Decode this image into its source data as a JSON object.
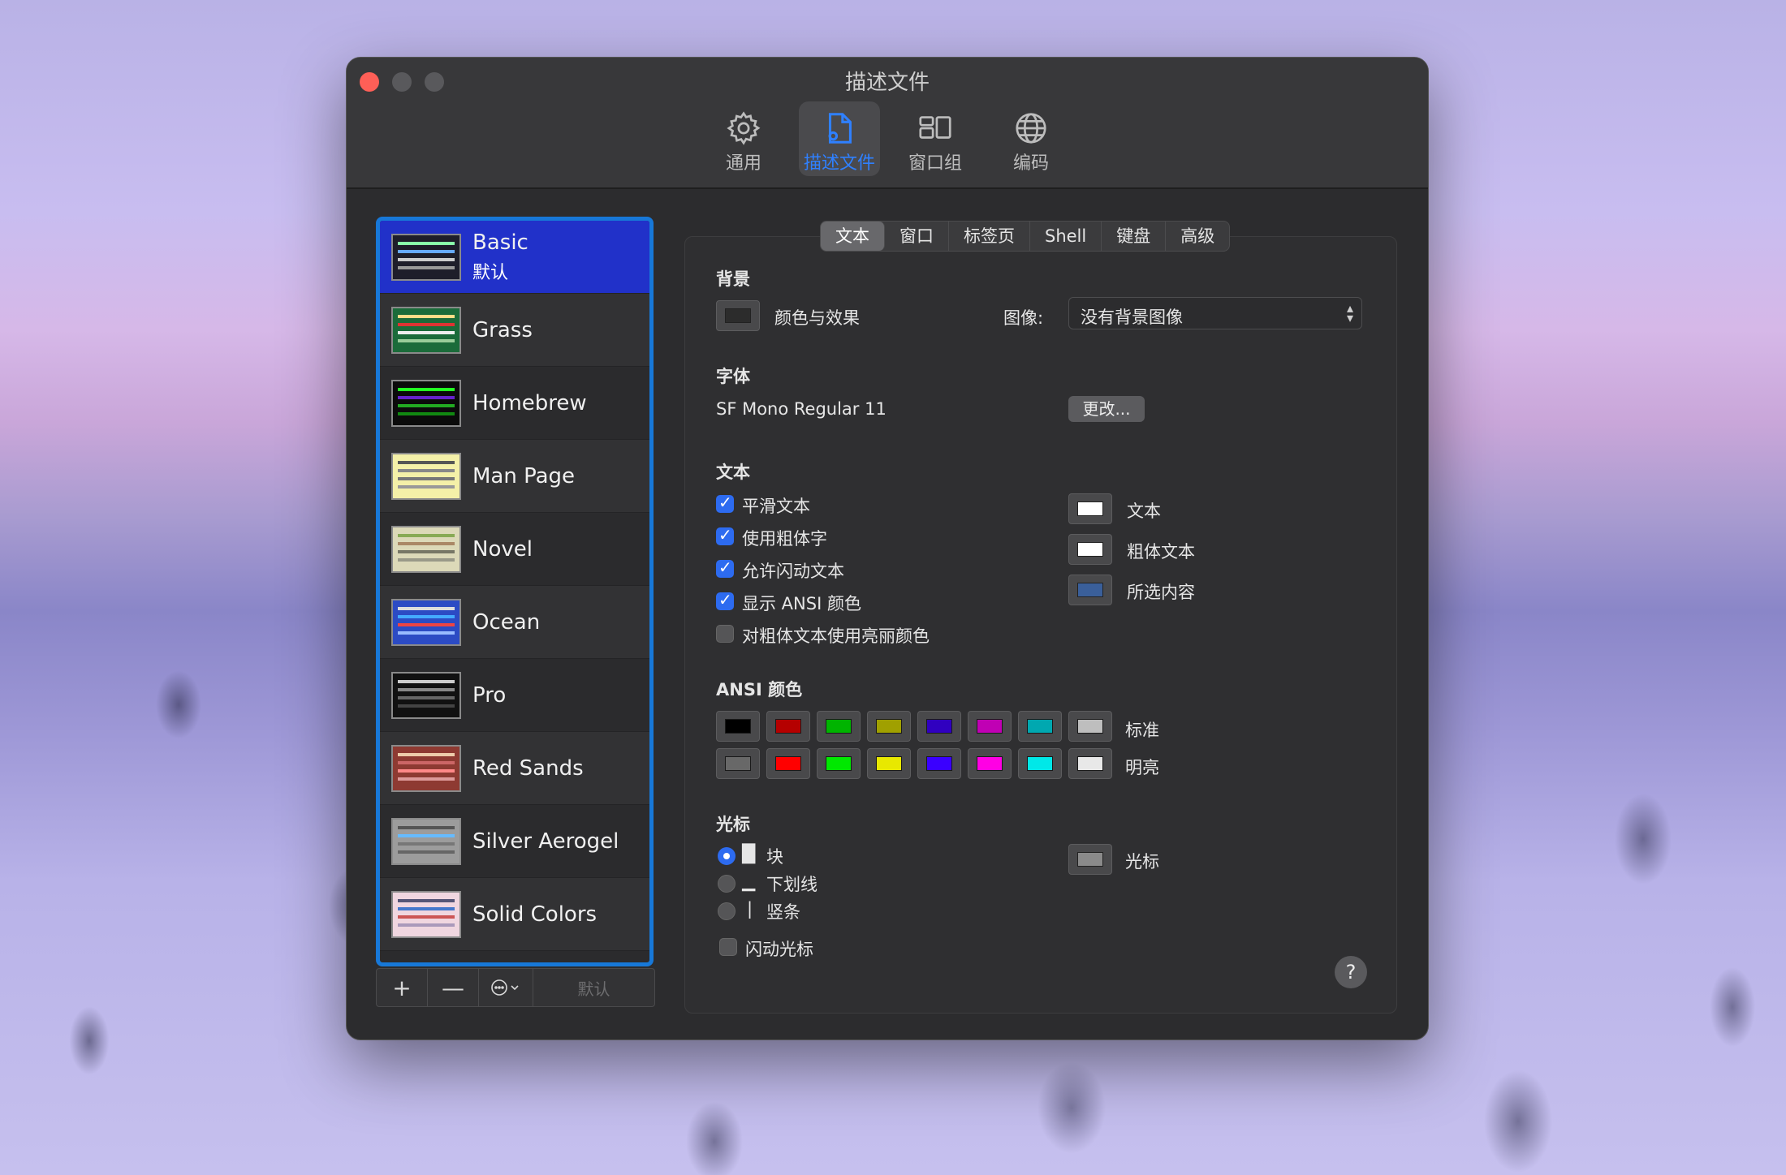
{
  "window": {
    "title": "描述文件"
  },
  "toolbar": [
    {
      "label": "通用",
      "icon": "gear-icon"
    },
    {
      "label": "描述文件",
      "icon": "profile-doc-icon"
    },
    {
      "label": "窗口组",
      "icon": "window-group-icon"
    },
    {
      "label": "编码",
      "icon": "globe-icon"
    }
  ],
  "profiles": [
    {
      "name": "Basic",
      "sub": "默认",
      "bg": "#1e1e2a",
      "selected": true
    },
    {
      "name": "Grass",
      "bg": "#1b6b3a"
    },
    {
      "name": "Homebrew",
      "bg": "#0b0b0b"
    },
    {
      "name": "Man Page",
      "bg": "#f4f0a8"
    },
    {
      "name": "Novel",
      "bg": "#dcd9b8"
    },
    {
      "name": "Ocean",
      "bg": "#2c4bc4"
    },
    {
      "name": "Pro",
      "bg": "#111111"
    },
    {
      "name": "Red Sands",
      "bg": "#8e3a32"
    },
    {
      "name": "Silver Aerogel",
      "bg": "#9c9c9c"
    },
    {
      "name": "Solid Colors",
      "bg": "#f0d6e0"
    }
  ],
  "bottom_bar": {
    "plus": "+",
    "minus": "—",
    "default": "默认"
  },
  "tabs": [
    "文本",
    "窗口",
    "标签页",
    "Shell",
    "键盘",
    "高级"
  ],
  "background": {
    "heading": "背景",
    "color_effects": "颜色与效果",
    "image_label": "图像:",
    "image_value": "没有背景图像"
  },
  "font": {
    "heading": "字体",
    "value": "SF Mono Regular 11",
    "change": "更改..."
  },
  "text": {
    "heading": "文本",
    "options": [
      {
        "label": "平滑文本",
        "checked": true
      },
      {
        "label": "使用粗体字",
        "checked": true
      },
      {
        "label": "允许闪动文本",
        "checked": true
      },
      {
        "label": "显示 ANSI 颜色",
        "checked": true
      },
      {
        "label": "对粗体文本使用亮丽颜色",
        "checked": false
      }
    ],
    "colors": [
      {
        "label": "文本",
        "color": "#ffffff"
      },
      {
        "label": "粗体文本",
        "color": "#ffffff"
      },
      {
        "label": "所选内容",
        "color": "#3a5f9a"
      }
    ]
  },
  "ansi": {
    "heading": "ANSI 颜色",
    "standard_label": "标准",
    "bright_label": "明亮",
    "standard": [
      "#000000",
      "#b50000",
      "#00b400",
      "#a0a000",
      "#3000c0",
      "#c000b4",
      "#00a8b0",
      "#bebebe"
    ],
    "bright": [
      "#686868",
      "#ff0000",
      "#00e800",
      "#e8e800",
      "#3a00ff",
      "#ff00e4",
      "#00e8e8",
      "#e8e8e8"
    ]
  },
  "cursor": {
    "heading": "光标",
    "options": [
      {
        "glyph": "█",
        "label": "块",
        "selected": true
      },
      {
        "glyph": "▁",
        "label": "下划线",
        "selected": false
      },
      {
        "glyph": "|",
        "label": "竖条",
        "selected": false
      }
    ],
    "blink": "闪动光标",
    "color_label": "光标",
    "color": "#8a8a8a"
  },
  "help": "?"
}
